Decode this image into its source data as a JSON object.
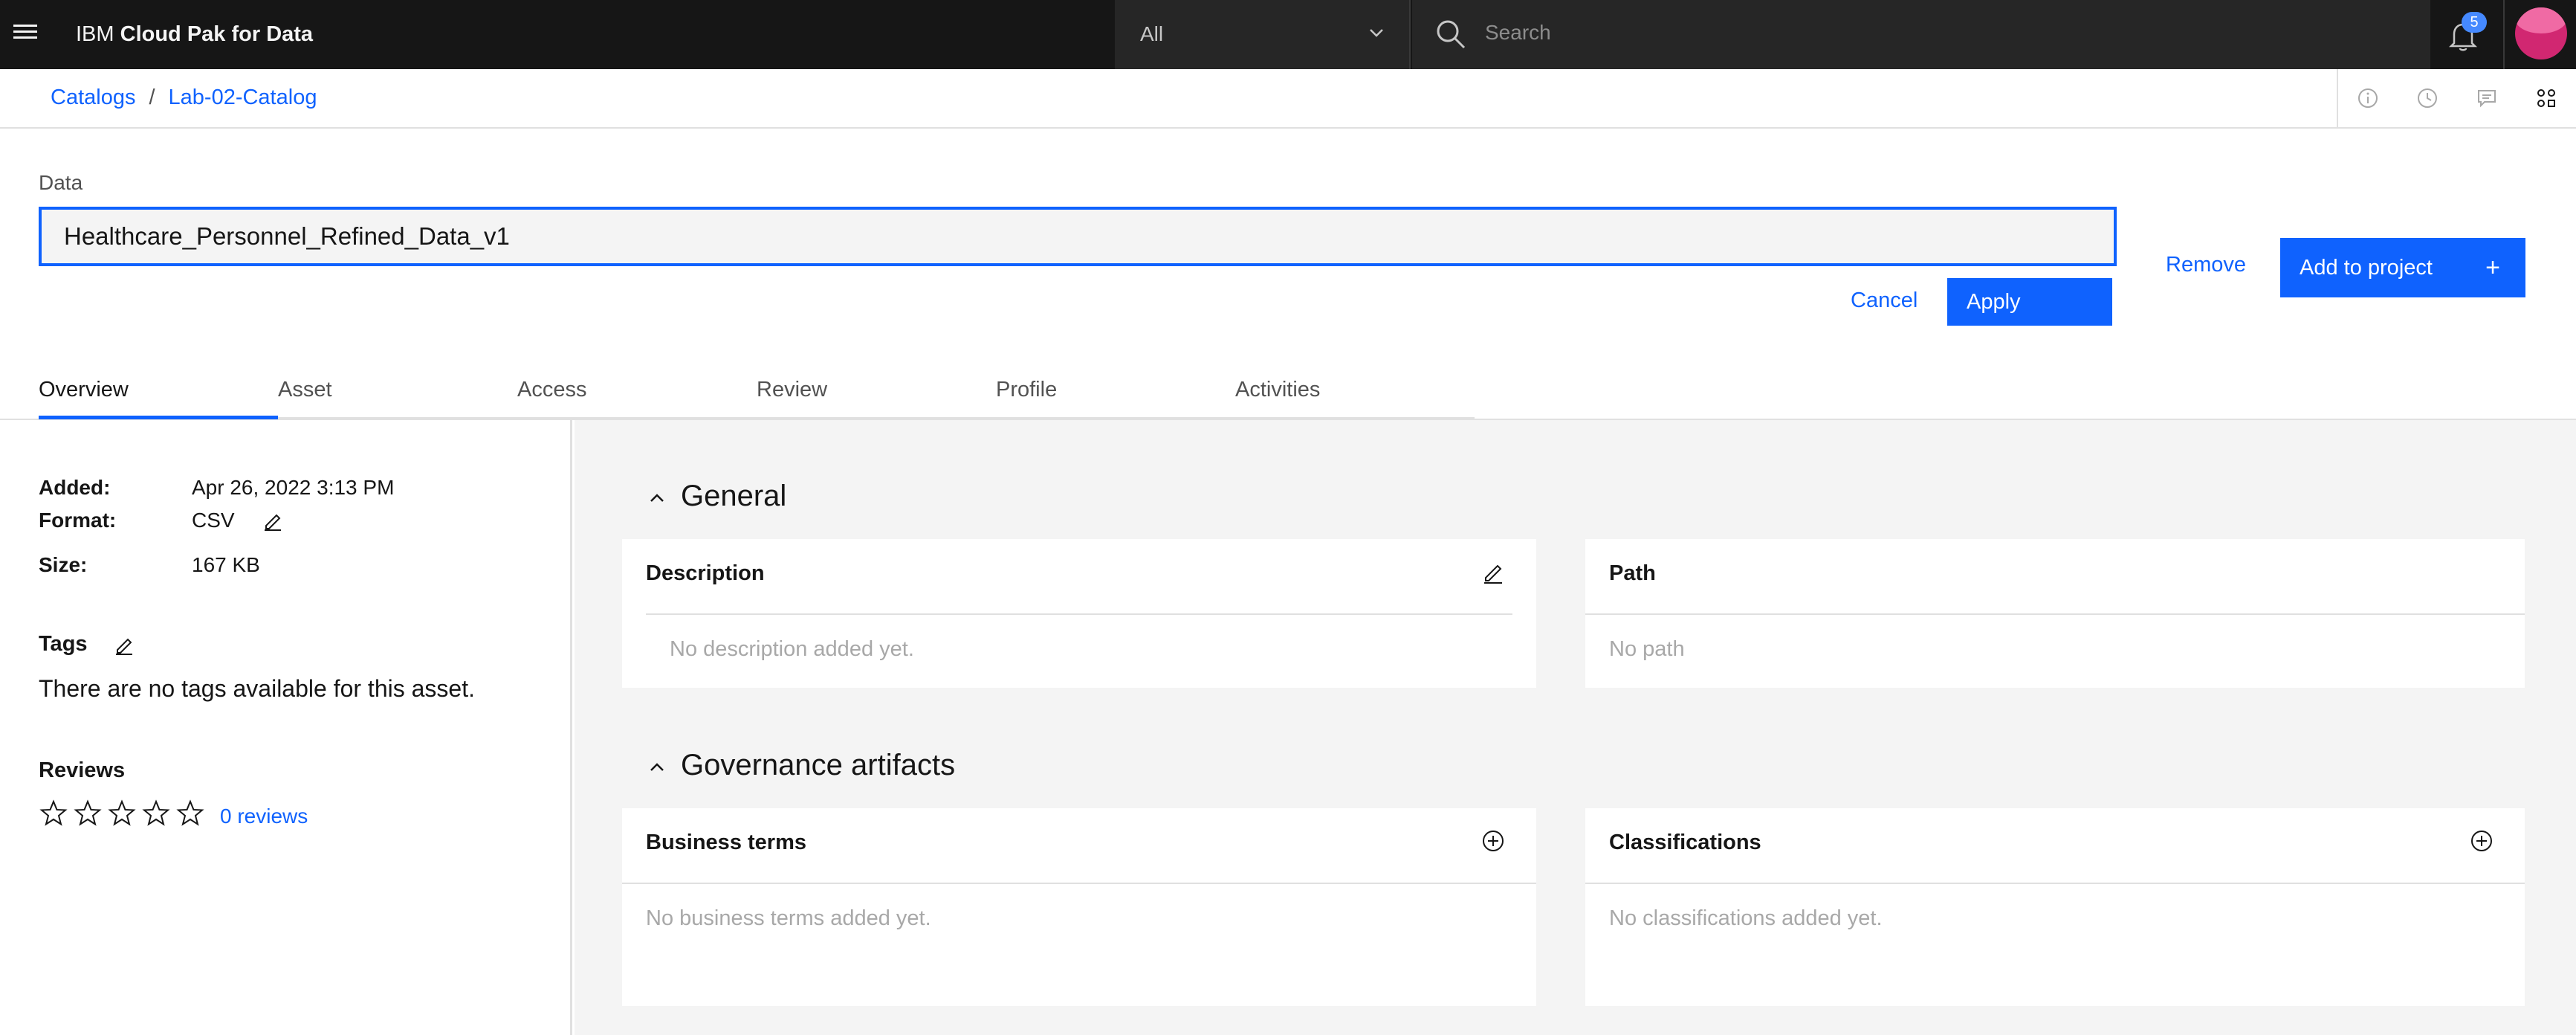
{
  "topbar": {
    "brand_prefix": "IBM",
    "brand_name": "Cloud Pak for Data",
    "scope_value": "All",
    "search_placeholder": "Search",
    "notification_count": "5"
  },
  "breadcrumb": {
    "items": [
      "Catalogs",
      "Lab-02-Catalog"
    ],
    "separator": "/"
  },
  "asset": {
    "data_label": "Data",
    "name": "Healthcare_Personnel_Refined_Data_v1",
    "cancel_label": "Cancel",
    "apply_label": "Apply",
    "remove_label": "Remove",
    "add_to_project_label": "Add to project",
    "add_icon": "+"
  },
  "tabs": [
    "Overview",
    "Asset",
    "Access",
    "Review",
    "Profile",
    "Activities"
  ],
  "details": {
    "added_label": "Added:",
    "added_value": "Apr 26, 2022 3:13 PM",
    "format_label": "Format:",
    "format_value": "CSV",
    "size_label": "Size:",
    "size_value": "167 KB"
  },
  "tags": {
    "title": "Tags",
    "empty_text": "There are no tags available for this asset."
  },
  "reviews": {
    "title": "Reviews",
    "rating": 0,
    "max_rating": 5,
    "link_text": "0 reviews"
  },
  "general": {
    "title": "General",
    "description_title": "Description",
    "description_empty": "No description added yet.",
    "path_title": "Path",
    "path_empty": "No path"
  },
  "governance": {
    "title": "Governance artifacts",
    "business_terms_title": "Business terms",
    "business_terms_empty": "No business terms added yet.",
    "classifications_title": "Classifications",
    "classifications_empty": "No classifications added yet."
  },
  "colors": {
    "accent": "#0f62fe",
    "topbar": "#161616",
    "avatar": "#d12771"
  }
}
